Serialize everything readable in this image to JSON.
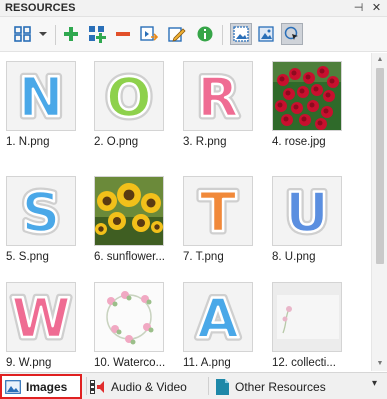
{
  "panel": {
    "title": "RESOURCES"
  },
  "titlebar": {
    "pin_glyph": "⊣",
    "close_glyph": "✕"
  },
  "toolbar": {
    "tools": [
      {
        "name": "view-mode-icon"
      },
      {
        "name": "dropdown-arrow-icon"
      },
      {
        "name": "add-icon"
      },
      {
        "name": "select-all-icon"
      },
      {
        "name": "remove-icon"
      },
      {
        "name": "export-icon"
      },
      {
        "name": "edit-icon"
      },
      {
        "name": "info-icon"
      },
      {
        "name": "image-view-icon"
      },
      {
        "name": "image-preview-icon"
      },
      {
        "name": "pointer-icon"
      }
    ]
  },
  "resources": [
    {
      "label": "1. N.png",
      "kind": "letter",
      "char": "N",
      "color": "#4aa8e8"
    },
    {
      "label": "2. O.png",
      "kind": "letter",
      "char": "O",
      "color": "#8ed14c"
    },
    {
      "label": "3. R.png",
      "kind": "letter",
      "char": "R",
      "color": "#ef6c93"
    },
    {
      "label": "4. rose.jpg",
      "kind": "photo-rose"
    },
    {
      "label": "5. S.png",
      "kind": "letter",
      "char": "S",
      "color": "#4aa8e8"
    },
    {
      "label": "6. sunflower...",
      "kind": "photo-sunflower"
    },
    {
      "label": "7. T.png",
      "kind": "letter",
      "char": "T",
      "color": "#f1893a"
    },
    {
      "label": "8. U.png",
      "kind": "letter",
      "char": "U",
      "color": "#5b8fe0"
    },
    {
      "label": "9. W.png",
      "kind": "letter",
      "char": "W",
      "color": "#ef6c93"
    },
    {
      "label": "10. Waterco...",
      "kind": "wreath"
    },
    {
      "label": "11. A.png",
      "kind": "letter",
      "char": "A",
      "color": "#4aa8e8"
    },
    {
      "label": "12. collecti...",
      "kind": "collection"
    }
  ],
  "tabs": [
    {
      "label": "Images",
      "active": true
    },
    {
      "label": "Audio & Video",
      "active": false
    },
    {
      "label": "Other Resources",
      "active": false
    }
  ],
  "tabs_overflow_glyph": "▾"
}
